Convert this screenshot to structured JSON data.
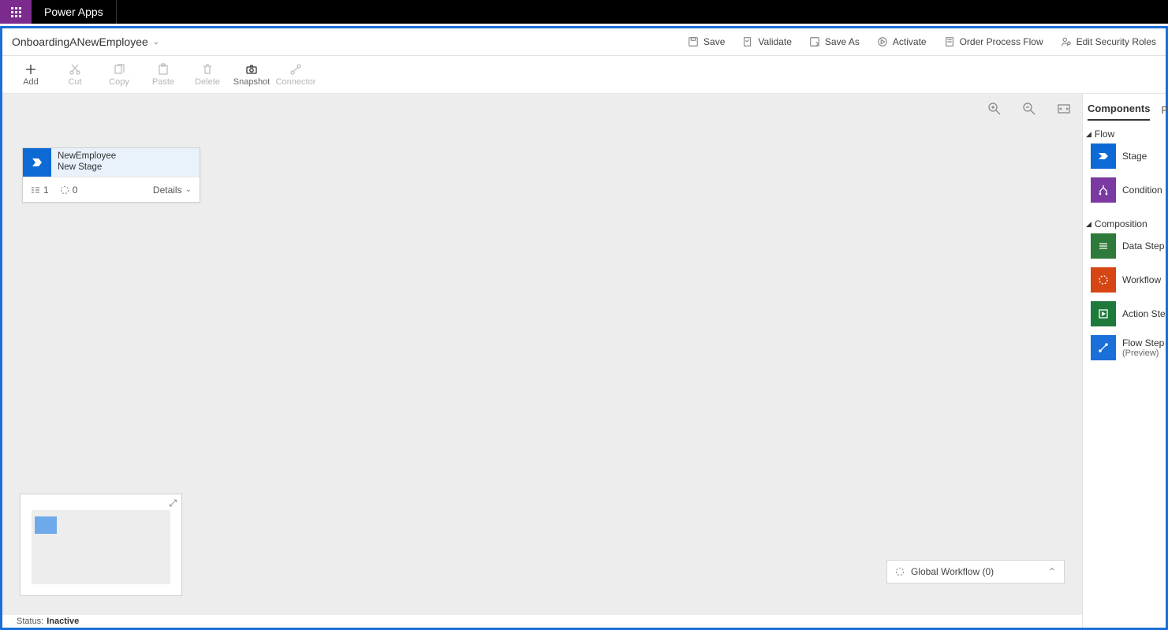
{
  "app": {
    "title": "Power Apps"
  },
  "process": {
    "name": "OnboardingANewEmployee"
  },
  "header_actions": {
    "save": "Save",
    "validate": "Validate",
    "save_as": "Save As",
    "activate": "Activate",
    "order": "Order Process Flow",
    "security": "Edit Security Roles"
  },
  "toolbar": {
    "add": "Add",
    "cut": "Cut",
    "copy": "Copy",
    "paste": "Paste",
    "delete": "Delete",
    "snapshot": "Snapshot",
    "connector": "Connector"
  },
  "stage": {
    "entity": "NewEmployee",
    "name": "New Stage",
    "step_count": "1",
    "wf_count": "0",
    "details": "Details"
  },
  "global_workflow": {
    "label": "Global Workflow (0)"
  },
  "status": {
    "label": "Status:",
    "value": "Inactive"
  },
  "panel": {
    "tab_components": "Components",
    "tab_properties_cut": "Pr",
    "section_flow": "Flow",
    "section_composition": "Composition",
    "items": {
      "stage": "Stage",
      "condition": "Condition",
      "data_step": "Data Step",
      "workflow": "Workflow",
      "action_step": "Action Ste",
      "flow_step": "Flow Step",
      "flow_step_sub": "(Preview)"
    }
  }
}
